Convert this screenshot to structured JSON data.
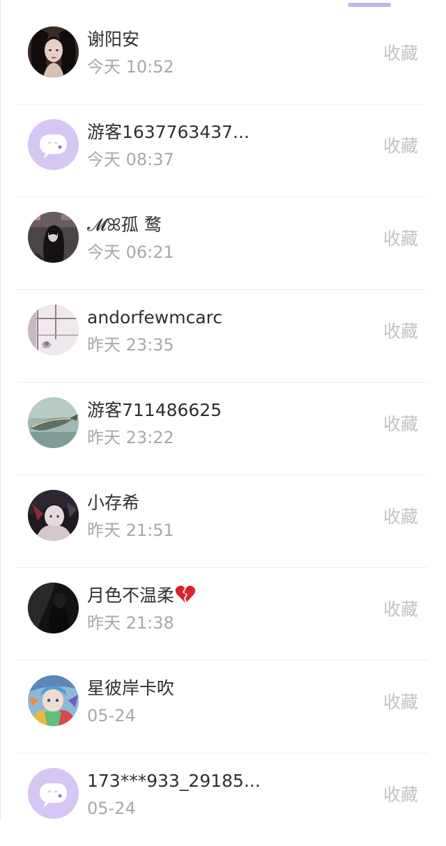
{
  "conversations": [
    {
      "name": "谢阳安",
      "time": "今天 10:52",
      "action": "收藏",
      "avatar": "photo-girl-dark-hair"
    },
    {
      "name": "游客1637763437...",
      "time": "今天 08:37",
      "action": "收藏",
      "avatar": "default-chat-bubble"
    },
    {
      "name": "𝓜ꕤ孤 鹜",
      "time": "今天 06:21",
      "action": "收藏",
      "avatar": "photo-dark-room"
    },
    {
      "name": "andorfewmcarc",
      "time": "昨天 23:35",
      "action": "收藏",
      "avatar": "photo-window-pale"
    },
    {
      "name": "游客711486625",
      "time": "昨天 23:22",
      "action": "收藏",
      "avatar": "photo-fish-teal"
    },
    {
      "name": "小存希",
      "time": "昨天 21:51",
      "action": "收藏",
      "avatar": "photo-anime-dark"
    },
    {
      "name": "月色不温柔",
      "time": "昨天 21:38",
      "action": "收藏",
      "avatar": "photo-black-figure",
      "emoji": "broken-heart"
    },
    {
      "name": "星彼岸卡吹",
      "time": "05-24",
      "action": "收藏",
      "avatar": "photo-colorful-anime"
    },
    {
      "name": "173***933_29185...",
      "time": "05-24",
      "action": "收藏",
      "avatar": "default-chat-bubble"
    }
  ],
  "colors": {
    "accent": "#c7b6ec",
    "default_avatar_bg": "#d6c6f4",
    "name_text": "#2f2f2f",
    "time_text": "#a8a8a8",
    "action_text": "#c3c3c3",
    "broken_heart": "#d8242f"
  }
}
